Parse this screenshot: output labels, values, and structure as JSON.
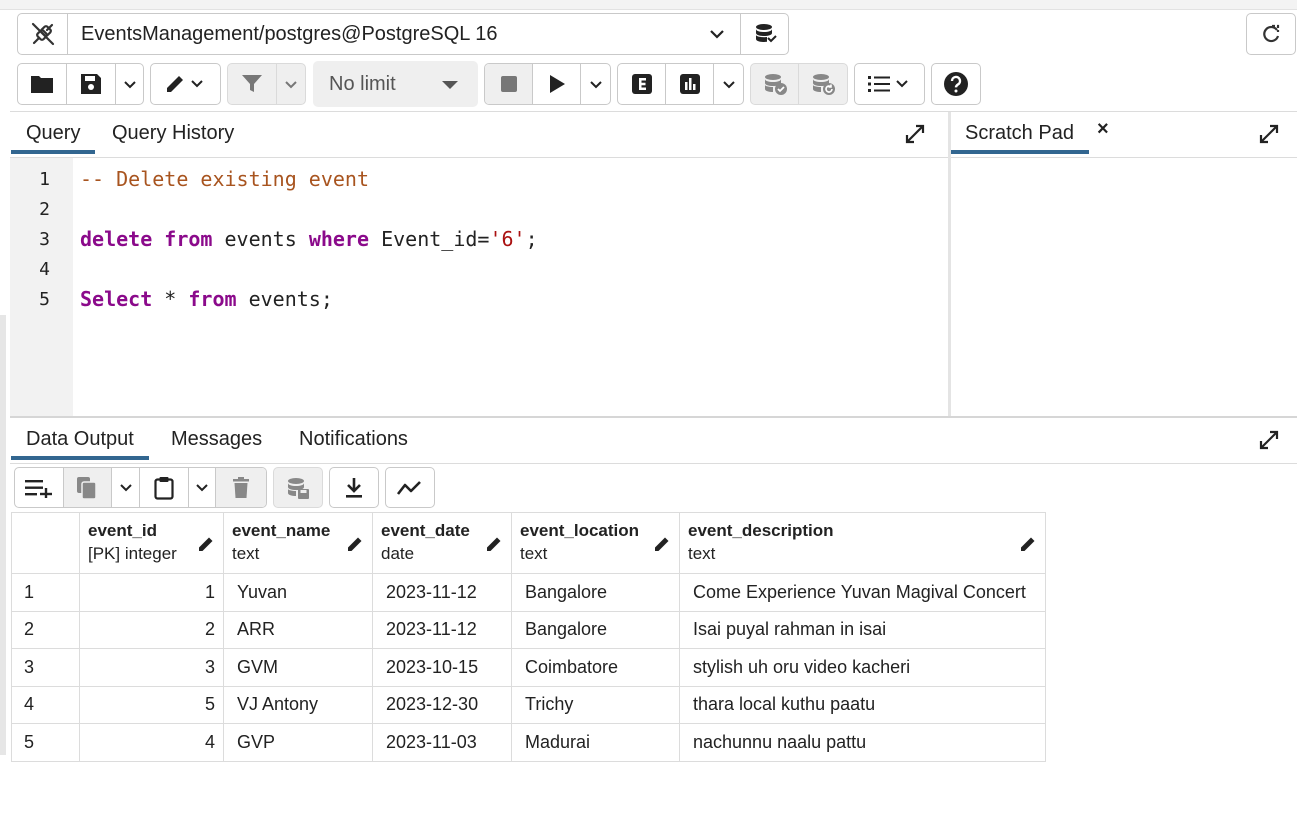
{
  "connection": {
    "label": "EventsManagement/postgres@PostgreSQL 16"
  },
  "toolbar": {
    "limit_label": "No limit"
  },
  "query_panel": {
    "tabs": [
      {
        "label": "Query",
        "active": true
      },
      {
        "label": "Query History",
        "active": false
      }
    ]
  },
  "scratch_pad": {
    "label": "Scratch Pad",
    "close_label": "×"
  },
  "editor": {
    "line_numbers": [
      "1",
      "2",
      "3",
      "4",
      "5"
    ],
    "lines": [
      "-- Delete existing event",
      "",
      "delete from events where Event_id='6';",
      "",
      "Select * from events;"
    ]
  },
  "output_panel": {
    "tabs": [
      {
        "label": "Data Output",
        "active": true
      },
      {
        "label": "Messages",
        "active": false
      },
      {
        "label": "Notifications",
        "active": false
      }
    ]
  },
  "grid": {
    "columns": [
      {
        "name": "event_id",
        "type": "[PK] integer"
      },
      {
        "name": "event_name",
        "type": "text"
      },
      {
        "name": "event_date",
        "type": "date"
      },
      {
        "name": "event_location",
        "type": "text"
      },
      {
        "name": "event_description",
        "type": "text"
      }
    ],
    "rows": [
      [
        "1",
        "1",
        "Yuvan",
        "2023-11-12",
        "Bangalore",
        "Come Experience Yuvan Magival Concert"
      ],
      [
        "2",
        "2",
        "ARR",
        "2023-11-12",
        "Bangalore",
        "Isai puyal rahman in isai"
      ],
      [
        "3",
        "3",
        "GVM",
        "2023-10-15",
        "Coimbatore",
        "stylish uh oru video kacheri"
      ],
      [
        "4",
        "5",
        "VJ Antony",
        "2023-12-30",
        "Trichy",
        "thara local kuthu paatu"
      ],
      [
        "5",
        "4",
        "GVP",
        "2023-11-03",
        "Madurai",
        "nachunnu naalu pattu"
      ]
    ]
  }
}
